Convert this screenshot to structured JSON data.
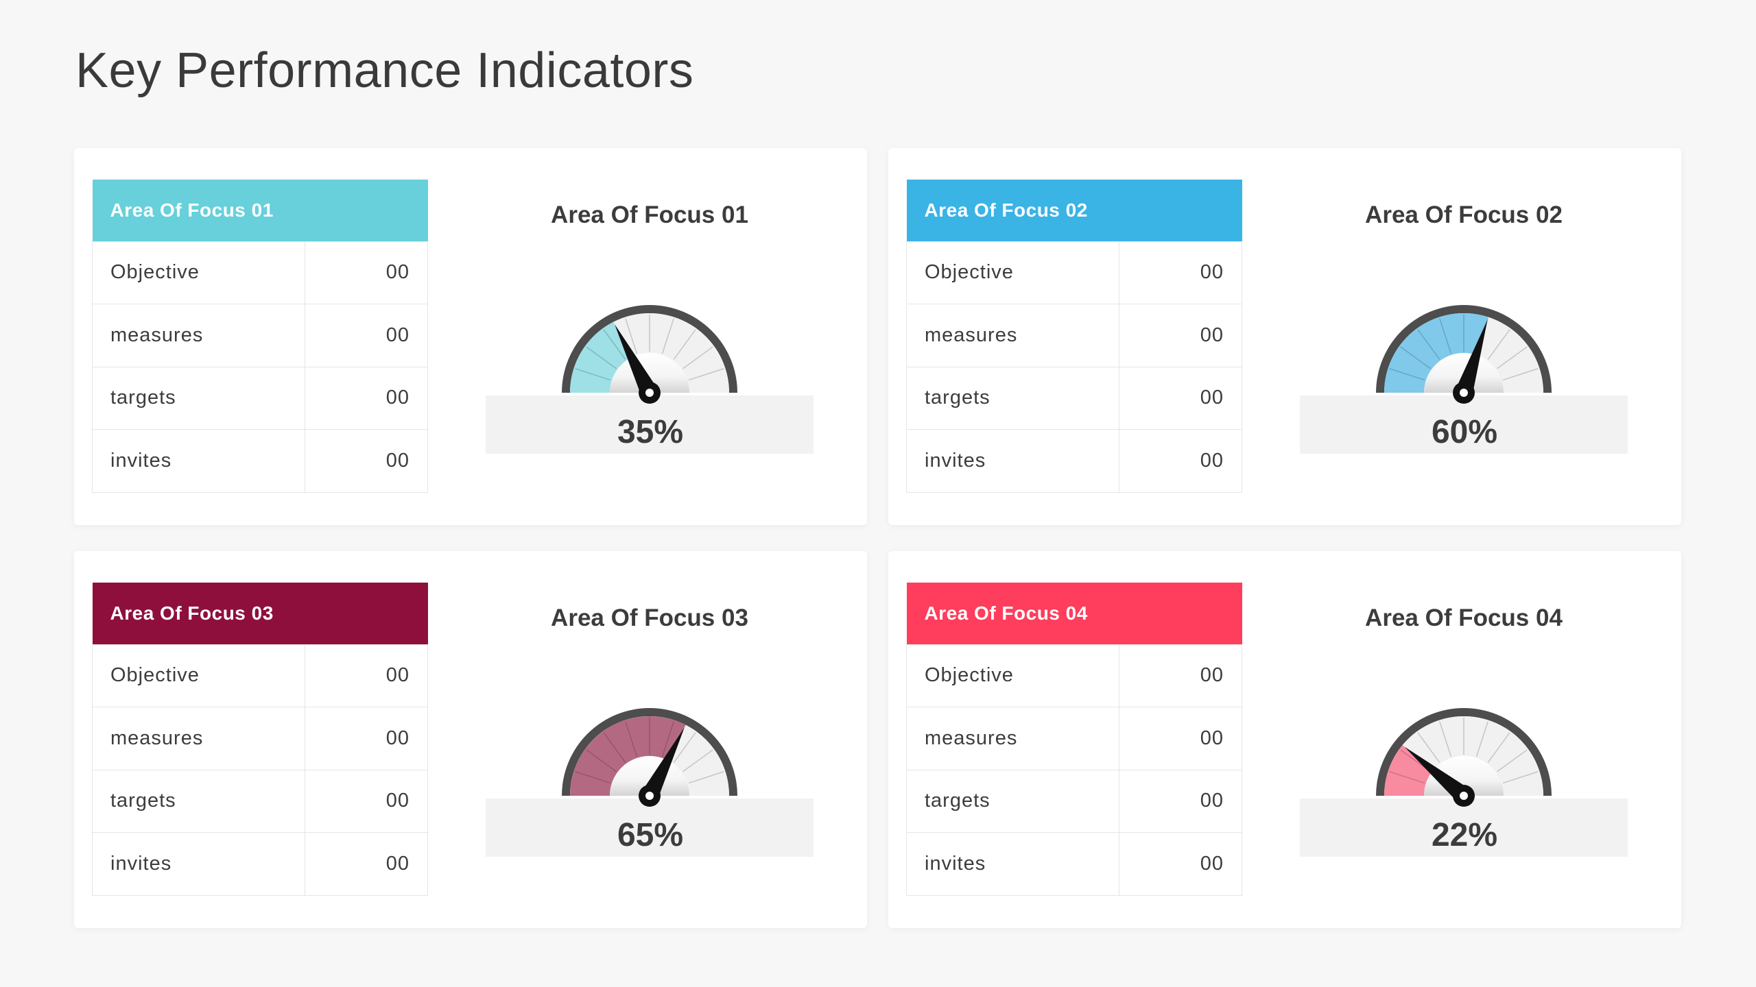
{
  "title": "Key Performance Indicators",
  "cards": [
    {
      "header": "Area Of Focus 01",
      "color": "#67d0da",
      "fill": "#9ee0e6",
      "gauge_title": "Area Of Focus 01",
      "value_label": "35%",
      "percent": 35,
      "rows": [
        {
          "label": "Objective",
          "value": "00"
        },
        {
          "label": "measures",
          "value": "00"
        },
        {
          "label": "targets",
          "value": "00"
        },
        {
          "label": "invites",
          "value": "00"
        }
      ]
    },
    {
      "header": "Area Of Focus 02",
      "color": "#3ab3e5",
      "fill": "#80c9ea",
      "gauge_title": "Area Of Focus 02",
      "value_label": "60%",
      "percent": 60,
      "rows": [
        {
          "label": "Objective",
          "value": "00"
        },
        {
          "label": "measures",
          "value": "00"
        },
        {
          "label": "targets",
          "value": "00"
        },
        {
          "label": "invites",
          "value": "00"
        }
      ]
    },
    {
      "header": "Area Of Focus 03",
      "color": "#8e0f3c",
      "fill": "#b46982",
      "gauge_title": "Area Of Focus 03",
      "value_label": "65%",
      "percent": 65,
      "rows": [
        {
          "label": "Objective",
          "value": "00"
        },
        {
          "label": "measures",
          "value": "00"
        },
        {
          "label": "targets",
          "value": "00"
        },
        {
          "label": "invites",
          "value": "00"
        }
      ]
    },
    {
      "header": "Area Of Focus 04",
      "color": "#ff3d5c",
      "fill": "#f98ba0",
      "gauge_title": "Area Of Focus 04",
      "value_label": "22%",
      "percent": 22,
      "rows": [
        {
          "label": "Objective",
          "value": "00"
        },
        {
          "label": "measures",
          "value": "00"
        },
        {
          "label": "targets",
          "value": "00"
        },
        {
          "label": "invites",
          "value": "00"
        }
      ]
    }
  ]
}
